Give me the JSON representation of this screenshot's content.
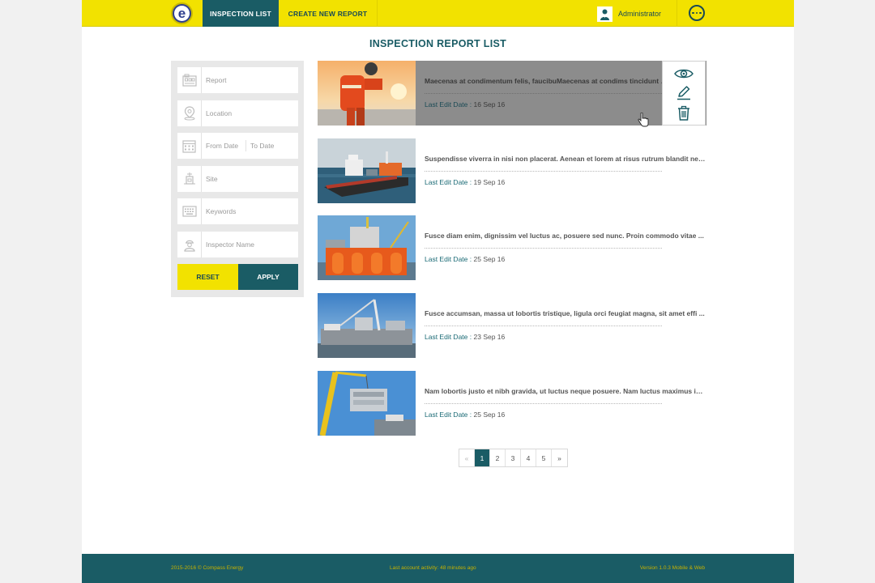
{
  "header": {
    "logo_letter": "e",
    "tabs": [
      {
        "label": "INSPECTION LIST",
        "active": true
      },
      {
        "label": "CREATE NEW REPORT",
        "active": false
      }
    ],
    "user_name": "Administrator",
    "more_icon": "more-horizontal-icon"
  },
  "title": "INSPECTION REPORT LIST",
  "filters": {
    "report_placeholder": "Report",
    "location_placeholder": "Location",
    "from_date_placeholder": "From Date",
    "to_date_placeholder": "To Date",
    "site_placeholder": "Site",
    "keywords_placeholder": "Keywords",
    "inspector_placeholder": "Inspector Name",
    "reset_label": "RESET",
    "apply_label": "APPLY"
  },
  "reports": [
    {
      "description": "Maecenas at condimentum felis, faucibuMaecenas at condims tincidunt lig",
      "date_label": "Last Edit Date :",
      "date": "16 Sep 16",
      "image": "worker-on-offshore-deck"
    },
    {
      "description": "Suspendisse viverra in nisi non placerat. Aenean et lorem at risus rutrum blandit nec ...",
      "date_label": "Last Edit Date :",
      "date": "19 Sep 16",
      "image": "offshore-vessel-at-sea"
    },
    {
      "description": "Fusce diam enim, dignissim vel luctus ac, posuere sed nunc. Proin commodo vitae ...",
      "date_label": "Last Edit Date :",
      "date": "25 Sep 16",
      "image": "orange-drilling-rig"
    },
    {
      "description": "Fusce accumsan, massa ut lobortis tristique, ligula orci feugiat magna, sit amet effi ...",
      "date_label": "Last Edit Date :",
      "date": "23 Sep 16",
      "image": "ship-crane-deck"
    },
    {
      "description": "Nam lobortis justo et nibh gravida, ut luctus neque posuere. Nam luctus maximus im ...",
      "date_label": "Last Edit Date :",
      "date": "25 Sep 16",
      "image": "yellow-crane-module-lift"
    }
  ],
  "pagination": {
    "prev": "«",
    "pages": [
      "1",
      "2",
      "3",
      "4",
      "5"
    ],
    "next": "»",
    "current": "1"
  },
  "footer": {
    "copyright": "2015-2016 © Compass Energy",
    "last_activity": "Last account activity: 48 minutes ago",
    "version": "Version 1.0.3 Mobile & Web"
  },
  "colors": {
    "brand_yellow": "#f2e200",
    "brand_teal": "#1a5c65"
  }
}
